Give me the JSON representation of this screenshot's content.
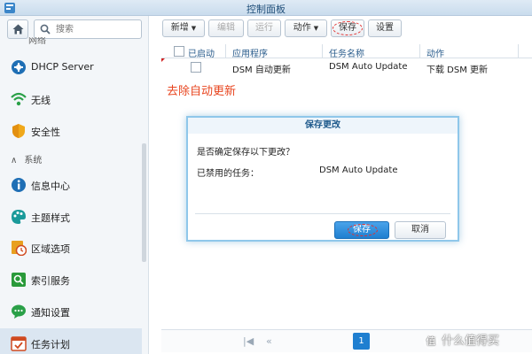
{
  "window": {
    "title": "控制面板"
  },
  "sidebar": {
    "search_placeholder": "搜索",
    "partial_item": "网络",
    "items": [
      {
        "label": "DHCP Server",
        "icon": "dhcp-icon"
      },
      {
        "label": "无线",
        "icon": "wifi-icon"
      },
      {
        "label": "安全性",
        "icon": "shield-icon"
      },
      {
        "label": "信息中心",
        "icon": "info-icon"
      },
      {
        "label": "主题样式",
        "icon": "palette-icon"
      },
      {
        "label": "区域选项",
        "icon": "regional-clock-icon"
      },
      {
        "label": "索引服务",
        "icon": "index-search-icon"
      },
      {
        "label": "通知设置",
        "icon": "chat-bubble-icon"
      },
      {
        "label": "任务计划",
        "icon": "calendar-icon"
      }
    ],
    "section_label": "系统"
  },
  "toolbar": {
    "new_label": "新增",
    "edit_label": "编辑",
    "run_label": "运行",
    "action_label": "动作",
    "save_label": "保存",
    "settings_label": "设置"
  },
  "table": {
    "columns": [
      "已启动",
      "应用程序",
      "任务名称",
      "动作"
    ],
    "rows": [
      {
        "enabled": false,
        "app": "DSM 自动更新",
        "task": "DSM Auto Update",
        "action": "下载 DSM 更新"
      }
    ]
  },
  "annotation": "去除自动更新",
  "dialog": {
    "title": "保存更改",
    "question": "是否确定保存以下更改？",
    "disabled_label": "已禁用的任务：",
    "disabled_value": "DSM Auto Update",
    "save_label": "保存",
    "cancel_label": "取消"
  },
  "pager": {
    "current_page": "1"
  },
  "watermark": "什么值得买",
  "colors": {
    "accent": "#1f7fd0",
    "annotation": "#e8451f",
    "highlight_ring": "#e03030"
  }
}
